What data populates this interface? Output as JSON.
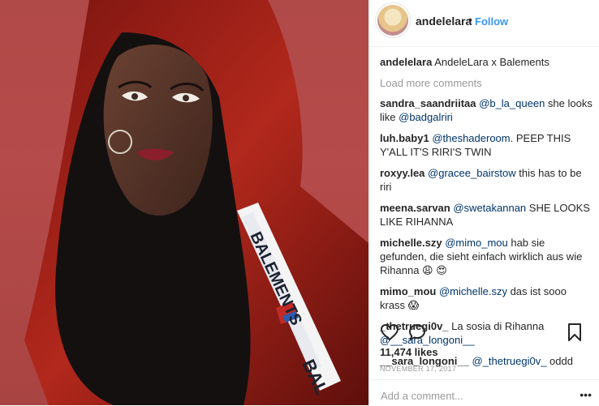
{
  "post": {
    "username": "andelelara",
    "follow_label": "Follow",
    "caption_user": "andelelara",
    "caption_text": "AndeleLara x Balements",
    "load_more": "Load more comments",
    "likes": "11,474 likes",
    "date": "NOVEMBER 17, 2017",
    "add_comment_placeholder": "Add a comment...",
    "more_label": "•••",
    "photo_print": "BALEMENTS",
    "photo_print_lower": "BAL"
  },
  "comments": [
    {
      "user": "sandra_saandriitaa",
      "mention": "@b_la_queen",
      "text": " she looks like ",
      "mention2": "@badgalriri",
      "text2": ""
    },
    {
      "user": "luh.baby1",
      "mention": "@theshaderoom",
      "text": ". PEEP THIS Y'ALL IT'S RIRI'S TWIN",
      "mention2": "",
      "text2": ""
    },
    {
      "user": "roxyy.lea",
      "mention": "@gracee_bairstow",
      "text": " this has to be riri",
      "mention2": "",
      "text2": ""
    },
    {
      "user": "meena.sarvan",
      "mention": "@swetakannan",
      "text": " SHE LOOKS LIKE RIHANNA",
      "mention2": "",
      "text2": ""
    },
    {
      "user": "michelle.szy",
      "mention": "@mimo_mou",
      "text": " hab sie gefunden, die sieht einfach wirklich aus wie Rihanna 😩 😍",
      "mention2": "",
      "text2": ""
    },
    {
      "user": "mimo_mou",
      "mention": "@michelle.szy",
      "text": " das ist sooo krass 😱",
      "mention2": "",
      "text2": ""
    },
    {
      "user": "_thetruegi0v_",
      "mention": "",
      "text": " La sosia di Rihanna ",
      "mention2": "@__sara_longoni__",
      "text2": ""
    },
    {
      "user": "__sara_longoni__",
      "mention": "@_thetruegi0v_",
      "text": " oddd",
      "mention2": "",
      "text2": ""
    }
  ],
  "icons": {
    "like": "heart-icon",
    "comment": "comment-bubble-icon",
    "save": "bookmark-icon"
  },
  "colors": {
    "link": "#003569",
    "follow": "#3897f0",
    "muted": "#999999"
  }
}
